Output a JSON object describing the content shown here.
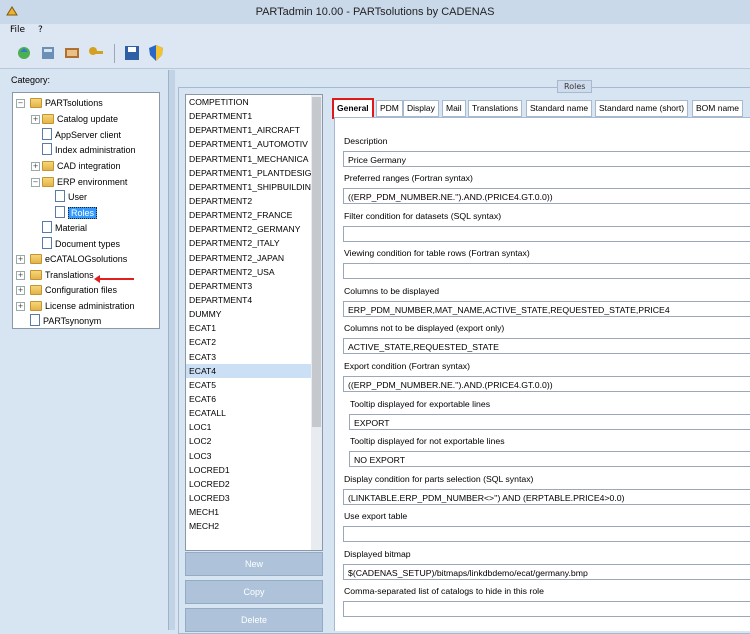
{
  "window": {
    "title": "PARTadmin 10.00 - PARTsolutions by CADENAS"
  },
  "menu": {
    "file": "File",
    "help": "?"
  },
  "left": {
    "category_label": "Category:",
    "tree": [
      "PARTsolutions",
      "Catalog update",
      "AppServer client",
      "Index administration",
      "CAD integration",
      "ERP environment",
      "User",
      "Roles",
      "Material",
      "Document types",
      "eCATALOGsolutions",
      "Translations",
      "Configuration files",
      "License administration",
      "PARTsynonym"
    ]
  },
  "roles": {
    "frame_title": "Roles",
    "list": [
      "COMPETITION",
      "DEPARTMENT1",
      "DEPARTMENT1_AIRCRAFT",
      "DEPARTMENT1_AUTOMOTIV",
      "DEPARTMENT1_MECHANICA",
      "DEPARTMENT1_PLANTDESIG",
      "DEPARTMENT1_SHIPBUILDIN",
      "DEPARTMENT2",
      "DEPARTMENT2_FRANCE",
      "DEPARTMENT2_GERMANY",
      "DEPARTMENT2_ITALY",
      "DEPARTMENT2_JAPAN",
      "DEPARTMENT2_USA",
      "DEPARTMENT3",
      "DEPARTMENT4",
      "DUMMY",
      "ECAT1",
      "ECAT2",
      "ECAT3",
      "ECAT4",
      "ECAT5",
      "ECAT6",
      "ECATALL",
      "LOC1",
      "LOC2",
      "LOC3",
      "LOCRED1",
      "LOCRED2",
      "LOCRED3",
      "MECH1",
      "MECH2"
    ],
    "selected": "ECAT4",
    "buttons": {
      "new": "New",
      "copy": "Copy",
      "delete": "Delete"
    },
    "tabs": [
      "General",
      "PDM",
      "Display",
      "Mail",
      "Translations",
      "Standard name",
      "Standard name (short)",
      "BOM name"
    ]
  },
  "form": {
    "description_label": "Description",
    "description_value": "Price Germany",
    "preferred_label": "Preferred ranges (Fortran syntax)",
    "preferred_value": "((ERP_PDM_NUMBER.NE.'').AND.(PRICE4.GT.0.0))",
    "filter_label": "Filter condition for datasets (SQL syntax)",
    "filter_value": "",
    "viewing_label": "Viewing condition for table rows (Fortran syntax)",
    "viewing_value": "",
    "columns_label": "Columns to be displayed",
    "columns_value": "ERP_PDM_NUMBER,MAT_NAME,ACTIVE_STATE,REQUESTED_STATE,PRICE4",
    "notcolumns_label": "Columns not to be displayed (export only)",
    "notcolumns_value": "ACTIVE_STATE,REQUESTED_STATE",
    "export_label": "Export condition (Fortran syntax)",
    "export_value": "((ERP_PDM_NUMBER.NE.'').AND.(PRICE4.GT.0.0))",
    "tip_exp_label": "Tooltip displayed for exportable lines",
    "tip_exp_value": "EXPORT",
    "tip_noexp_label": "Tooltip displayed for not exportable lines",
    "tip_noexp_value": "NO EXPORT",
    "display_label": "Display condition for parts selection (SQL syntax)",
    "display_value": "(LINKTABLE.ERP_PDM_NUMBER<>'') AND (ERPTABLE.PRICE4>0.0)",
    "usetable_label": "Use export table",
    "usetable_value": "",
    "bitmap_label": "Displayed bitmap",
    "bitmap_value": "$(CADENAS_SETUP)/bitmaps/linkdbdemo/ecat/germany.bmp",
    "hide_label": "Comma-separated list of catalogs to hide in this role",
    "hide_value": ""
  }
}
